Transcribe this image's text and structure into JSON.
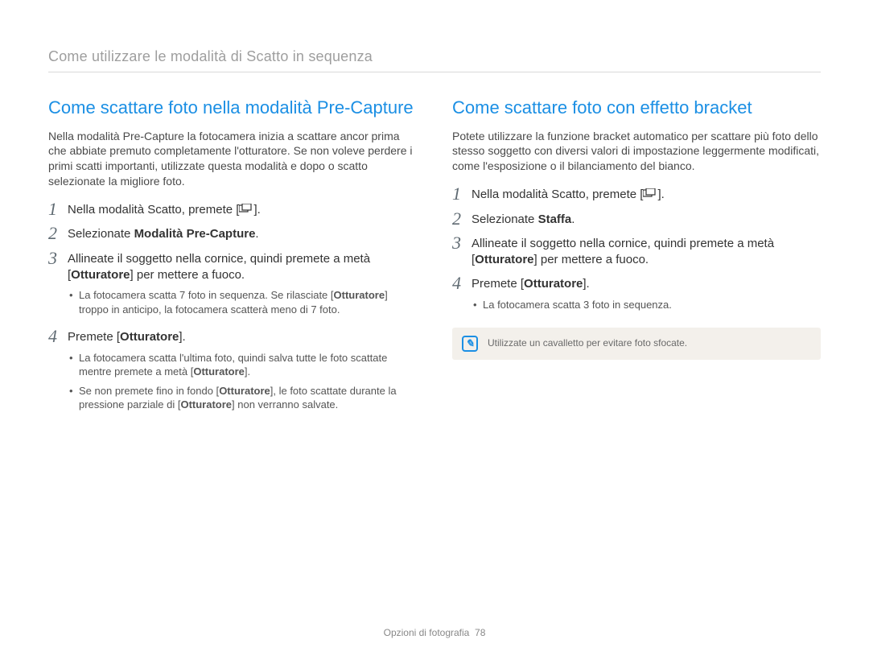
{
  "header": {
    "title": "Come utilizzare le modalità di Scatto in sequenza"
  },
  "left": {
    "heading": "Come scattare foto nella modalità Pre-Capture",
    "intro": "Nella modalità Pre-Capture la fotocamera inizia a scattare ancor prima che abbiate premuto completamente l'otturatore. Se non voleve perdere i primi scatti importanti, utilizzate questa modalità e dopo o scatto selezionate la migliore foto.",
    "step1_pre": "Nella modalità Scatto, premete [",
    "step1_post": "].",
    "step2_pre": "Selezionate ",
    "step2_bold": "Modalità Pre-Capture",
    "step2_post": ".",
    "step3_a": "Allineate il soggetto nella cornice, quindi premete a metà [",
    "step3_bold": "Otturatore",
    "step3_b": "] per mettere a fuoco.",
    "step3_bullet1_a": "La fotocamera scatta 7 foto in sequenza. Se rilasciate [",
    "step3_bullet1_bold": "Otturatore",
    "step3_bullet1_b": "] troppo in anticipo, la fotocamera scatterà meno di 7 foto.",
    "step4_a": "Premete [",
    "step4_bold": "Otturatore",
    "step4_b": "].",
    "step4_bullet1_a": "La fotocamera scatta l'ultima foto, quindi salva tutte le foto scattate mentre premete a metà [",
    "step4_bullet1_bold": "Otturatore",
    "step4_bullet1_b": "].",
    "step4_bullet2_a": "Se non premete fino in fondo [",
    "step4_bullet2_bold1": "Otturatore",
    "step4_bullet2_b": "], le foto scattate durante la pressione parziale di [",
    "step4_bullet2_bold2": "Otturatore",
    "step4_bullet2_c": "] non verranno salvate."
  },
  "right": {
    "heading": "Come scattare foto con effetto bracket",
    "intro": "Potete utilizzare la funzione bracket automatico per scattare più foto dello stesso soggetto con diversi valori di impostazione leggermente modificati, come l'esposizione o il bilanciamento del bianco.",
    "step1_pre": "Nella modalità Scatto, premete [",
    "step1_post": "].",
    "step2_pre": "Selezionate ",
    "step2_bold": "Staffa",
    "step2_post": ".",
    "step3_a": "Allineate il soggetto nella cornice, quindi premete a metà [",
    "step3_bold": "Otturatore",
    "step3_b": "] per mettere a fuoco.",
    "step4_a": "Premete [",
    "step4_bold": "Otturatore",
    "step4_b": "].",
    "step4_bullet1": "La fotocamera scatta 3 foto in sequenza.",
    "note": "Utilizzate un cavalletto per evitare foto sfocate."
  },
  "footer": {
    "section": "Opzioni di fotografia",
    "page": "78"
  },
  "nums": {
    "n1": "1",
    "n2": "2",
    "n3": "3",
    "n4": "4"
  }
}
